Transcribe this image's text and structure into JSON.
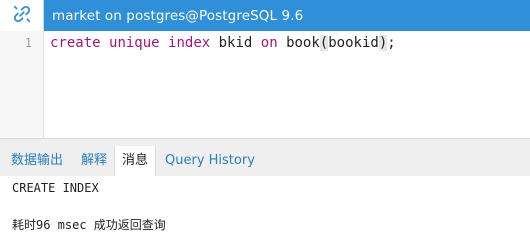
{
  "titlebar": {
    "icon": "connection-link-icon",
    "title": "market on postgres@PostgreSQL 9.6",
    "background": "#2f8fd8"
  },
  "editor": {
    "line_number": "1",
    "code": {
      "kw1": "create",
      "kw2": "unique",
      "kw3": "index",
      "name": "bkid",
      "kw4": "on",
      "table": "book",
      "open_paren": "(",
      "column": "bookid",
      "close_paren": ")",
      "terminator": ";"
    },
    "keyword_color": "#a0157e"
  },
  "tabs": [
    {
      "label": "数据输出",
      "active": false
    },
    {
      "label": "解释",
      "active": false
    },
    {
      "label": "消息",
      "active": true
    },
    {
      "label": "Query History",
      "active": false
    }
  ],
  "output": {
    "line1": "CREATE INDEX",
    "line2": "耗时96 msec 成功返回查询"
  }
}
